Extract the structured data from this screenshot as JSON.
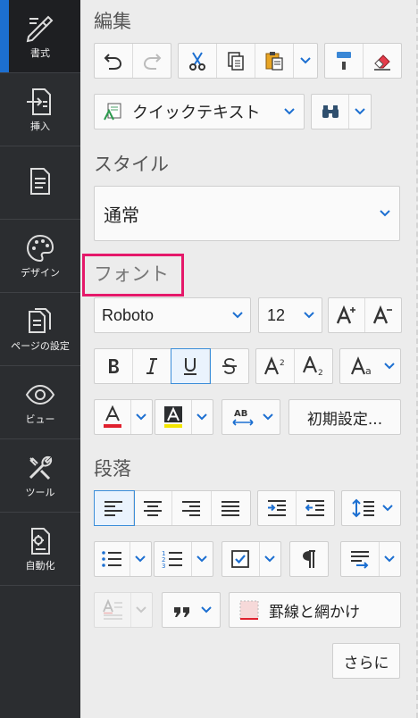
{
  "rail": {
    "items": [
      {
        "label": "書式"
      },
      {
        "label": "挿入"
      },
      {
        "label": ""
      },
      {
        "label": "デザイン"
      },
      {
        "label": "ページの設定"
      },
      {
        "label": "ビュー"
      },
      {
        "label": "ツール"
      },
      {
        "label": "自動化"
      }
    ]
  },
  "sections": {
    "edit": "編集",
    "style": "スタイル",
    "font": "フォント",
    "paragraph": "段落"
  },
  "quick_text": "クイックテキスト",
  "style_value": "通常",
  "font_family": "Roboto",
  "font_size": "12",
  "reset_label": "初期設定...",
  "borders_label": "罫線と網かけ",
  "more_label": "さらに",
  "colors": {
    "accent": "#1c6fd1",
    "highlight_box": "#e5196a",
    "font_color": "#e0202e",
    "highlight_color": "#f3e600",
    "rail_bg": "#2b2d30"
  }
}
